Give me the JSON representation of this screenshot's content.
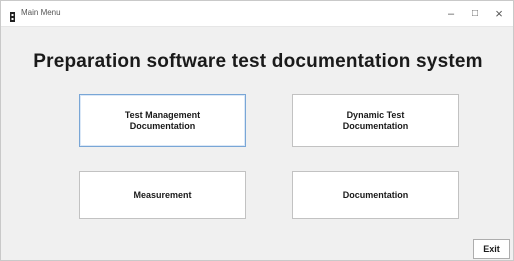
{
  "window": {
    "title": "Main Menu",
    "controls": {
      "minimize": "–",
      "maximize": "□",
      "close": "×"
    }
  },
  "heading": "Preparation software  test documentation system",
  "buttons": {
    "test_management": "Test Management\nDocumentation",
    "dynamic_test": "Dynamic Test\nDocumentation",
    "measurement": "Measurement",
    "documentation": "Documentation",
    "exit": "Exit"
  },
  "icons": {
    "app": "app-icon",
    "minimize": "minimize-icon",
    "maximize": "maximize-icon",
    "close": "close-icon"
  },
  "colors": {
    "window_bg": "#f0f0f0",
    "button_bg": "#ffffff",
    "focus_border": "#79a6d6"
  }
}
